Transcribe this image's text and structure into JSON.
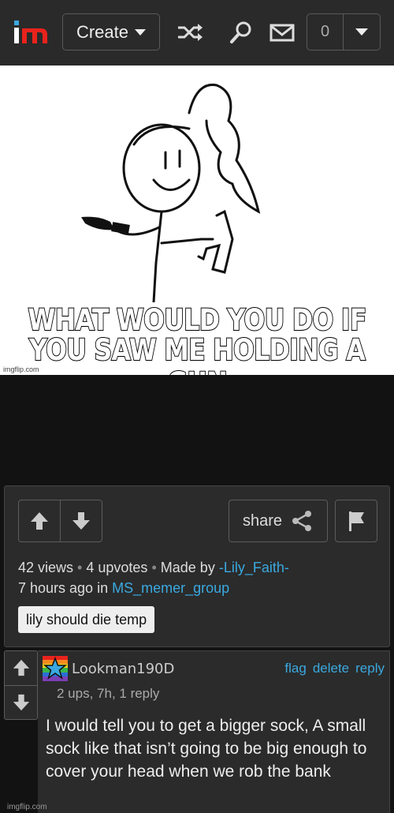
{
  "header": {
    "create_label": "Create",
    "notification_count": "0"
  },
  "meme": {
    "caption_line1": "WHAT WOULD YOU DO IF",
    "caption_line2": "YOU SAW ME HOLDING A GUN",
    "watermark": "imgflip.com"
  },
  "post": {
    "share_label": "share",
    "views": "42 views",
    "upvotes": "4 upvotes",
    "made_by_prefix": "Made by",
    "author": "-Lily_Faith-",
    "time_prefix": "7 hours ago in",
    "stream": "MS_memer_group",
    "tag": "lily should die temp"
  },
  "comment": {
    "username": "Lookman190D",
    "actions": {
      "flag": "flag",
      "delete": "delete",
      "reply": "reply"
    },
    "meta": "2 ups, 7h, 1 reply",
    "text": "I would tell you to get a bigger sock, A small sock like that isn’t going to be big enough to cover your head when we rob the bank"
  },
  "footer_watermark": "imgflip.com",
  "colors": {
    "link": "#3aa9e0",
    "logo_red": "#e8231c",
    "background": "#121212",
    "panel": "#2b2b2b"
  }
}
